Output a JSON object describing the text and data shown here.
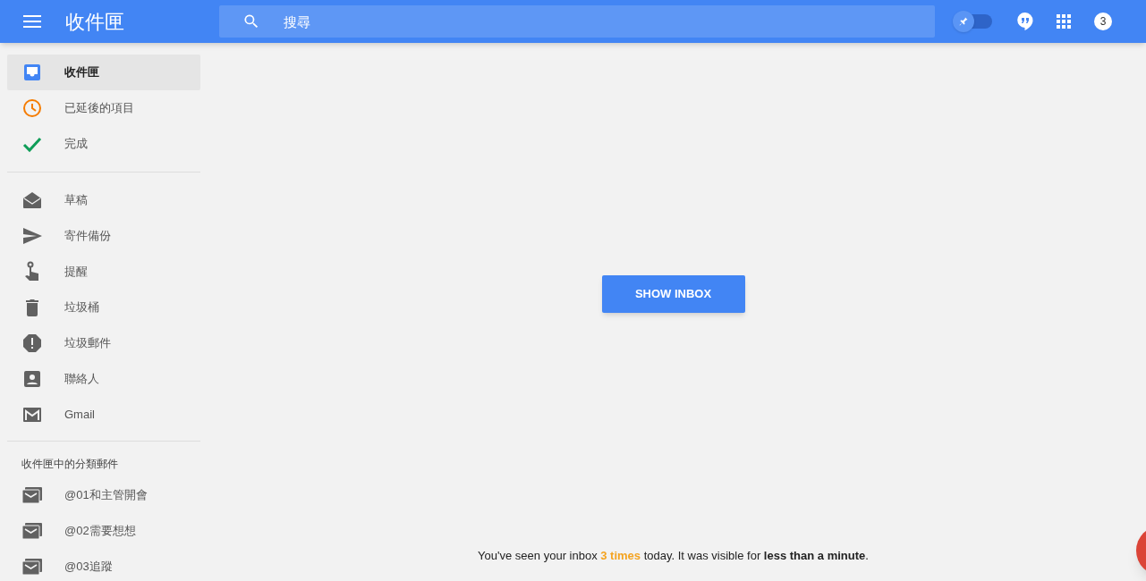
{
  "header": {
    "title": "收件匣",
    "search": {
      "placeholder": "搜尋"
    },
    "pin_toggle": {
      "on": false
    },
    "badge": "3"
  },
  "sidebar": {
    "primary": [
      {
        "label": "收件匣",
        "selected": true
      },
      {
        "label": "已延後的項目",
        "selected": false
      },
      {
        "label": "完成",
        "selected": false
      }
    ],
    "secondary": [
      {
        "label": "草稿",
        "selected": false
      },
      {
        "label": "寄件備份",
        "selected": false
      },
      {
        "label": "提醒",
        "selected": false
      },
      {
        "label": "垃圾桶",
        "selected": false
      },
      {
        "label": "垃圾郵件",
        "selected": false
      },
      {
        "label": "聯絡人",
        "selected": false
      },
      {
        "label": "Gmail",
        "selected": false
      }
    ],
    "bundles_heading": "收件匣中的分類郵件",
    "bundles": [
      {
        "label": "@01和主管開會",
        "selected": false
      },
      {
        "label": "@02需要想想",
        "selected": false
      },
      {
        "label": "@03追蹤",
        "selected": false
      }
    ]
  },
  "main": {
    "button": "SHOW INBOX",
    "footer": [
      {
        "kind": "plain",
        "text": "You've seen your inbox "
      },
      {
        "kind": "highlight",
        "text": "3 times"
      },
      {
        "kind": "plain",
        "text": " today. It was visible for "
      },
      {
        "kind": "bold",
        "text": "less than a minute"
      },
      {
        "kind": "plain",
        "text": "."
      }
    ]
  }
}
